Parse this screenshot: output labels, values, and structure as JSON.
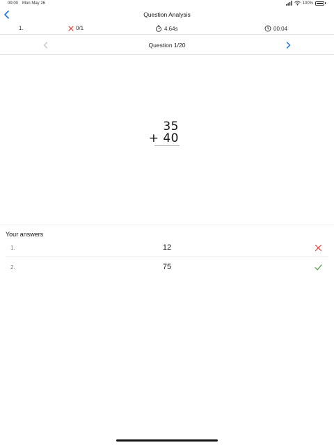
{
  "status_bar": {
    "time": "09:00",
    "date": "Mon May 26",
    "battery": "100%"
  },
  "nav": {
    "title": "Question Analysis",
    "back_icon": "chevron-left-icon"
  },
  "stats": {
    "index": "1.",
    "score": "0/1",
    "time": "4.64s",
    "duration": "00:04"
  },
  "question_nav": {
    "label": "Question 1/20"
  },
  "problem": {
    "top": "35",
    "bottom": "+ 40"
  },
  "answers": {
    "heading": "Your answers",
    "items": [
      {
        "index": "1.",
        "value": "12",
        "correct": false
      },
      {
        "index": "2.",
        "value": "75",
        "correct": true
      }
    ]
  },
  "colors": {
    "accent": "#1a73e8",
    "wrong": "#e53935",
    "right": "#43a047"
  }
}
